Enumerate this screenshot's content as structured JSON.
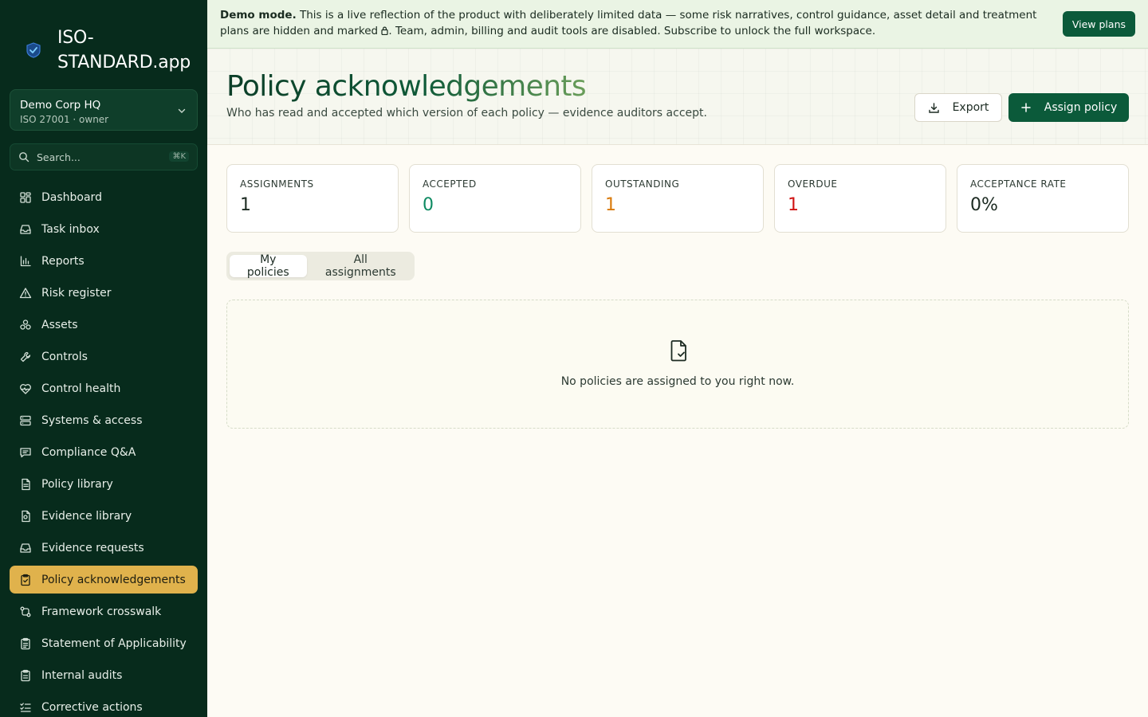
{
  "brand": {
    "name": "ISO-STANDARD.app"
  },
  "org": {
    "name": "Demo Corp HQ",
    "subtitle": "ISO 27001 · owner"
  },
  "search": {
    "placeholder": "Search...",
    "shortcut": "⌘K"
  },
  "nav": [
    {
      "label": "Dashboard",
      "icon": "dashboard-icon"
    },
    {
      "label": "Task inbox",
      "icon": "inbox-icon"
    },
    {
      "label": "Reports",
      "icon": "bar-chart-icon"
    },
    {
      "label": "Risk register",
      "icon": "warning-triangle-icon"
    },
    {
      "label": "Assets",
      "icon": "boxes-icon"
    },
    {
      "label": "Controls",
      "icon": "wrench-icon"
    },
    {
      "label": "Control health",
      "icon": "heart-pulse-icon"
    },
    {
      "label": "Systems & access",
      "icon": "server-icon"
    },
    {
      "label": "Compliance Q&A",
      "icon": "chat-icon"
    },
    {
      "label": "Policy library",
      "icon": "document-icon"
    },
    {
      "label": "Evidence library",
      "icon": "file-badge-icon"
    },
    {
      "label": "Evidence requests",
      "icon": "inbox-icon"
    },
    {
      "label": "Policy acknowledgements",
      "icon": "clipboard-check-icon",
      "active": true
    },
    {
      "label": "Framework crosswalk",
      "icon": "git-compare-icon"
    },
    {
      "label": "Statement of Applicability",
      "icon": "clipboard-list-icon"
    },
    {
      "label": "Internal audits",
      "icon": "clipboard-icon"
    },
    {
      "label": "Corrective actions",
      "icon": "list-checks-icon"
    }
  ],
  "banner": {
    "lead": "Demo mode.",
    "text_1": " This is a live reflection of the product with deliberately limited data — some risk narratives, control guidance, asset detail and treatment plans are hidden and marked ",
    "text_2": ". Team, admin, billing and audit tools are disabled. Subscribe to unlock the full workspace.",
    "button": "View plans"
  },
  "header": {
    "title": "Policy acknowledgements",
    "subtitle": "Who has read and accepted which version of each policy — evidence auditors accept.",
    "export_label": "Export",
    "assign_label": "Assign policy"
  },
  "stats": [
    {
      "label": "Assignments",
      "value": "1",
      "color": "#1c2b22"
    },
    {
      "label": "Accepted",
      "value": "0",
      "color": "#0e8a62"
    },
    {
      "label": "Outstanding",
      "value": "1",
      "color": "#d97a0b"
    },
    {
      "label": "Overdue",
      "value": "1",
      "color": "#d01414"
    },
    {
      "label": "Acceptance rate",
      "value": "0%",
      "color": "#1c2b22"
    }
  ],
  "tabs": [
    {
      "label": "My policies",
      "active": true
    },
    {
      "label": "All assignments",
      "active": false
    }
  ],
  "empty": {
    "message": "No policies are assigned to you right now.",
    "icon": "file-check-icon"
  },
  "colors": {
    "sidebar": "#072b1c",
    "accent": "#0b5a3a",
    "active_nav": "#e0b24c"
  }
}
